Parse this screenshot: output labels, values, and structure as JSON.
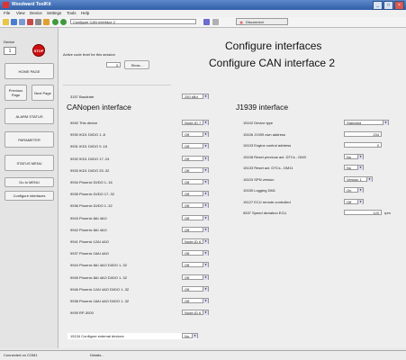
{
  "window": {
    "title": "Woodward ToolKit"
  },
  "menu": [
    "File",
    "View",
    "Device",
    "Settings",
    "Tools",
    "Help"
  ],
  "toolbar": {
    "combo_value": "Configure CAN Interface 2",
    "disconnect_label": "Disconnect"
  },
  "left": {
    "device_label": "Device",
    "device_number": "1",
    "stop_label": "STOP",
    "home": "HOME PAGE",
    "previous": "Previous Page",
    "next": "Next Page",
    "alarm": "ALARM STATUS",
    "parameter": "PARAMETER",
    "status_menu": "STATUS MENU",
    "goto_menu": "Go to MENU",
    "configure_interfaces": "Configure interfaces"
  },
  "header": {
    "title1": "Configure interfaces",
    "title2": "Configure CAN interface 2",
    "access_label": "Active code level for this session",
    "access_value": "3",
    "show_button": "Show..."
  },
  "baud": {
    "label": "3157 Baudrate",
    "value": "250 kBd"
  },
  "canopen": {
    "title": "CANopen interface",
    "rows": [
      {
        "label": "9940 This device",
        "value": "Node-ID 7"
      },
      {
        "label": "9930 IKD1 DI/DO 1..8",
        "value": "Off"
      },
      {
        "label": "9931 IKD1 DI/DO 9..16",
        "value": "Off"
      },
      {
        "label": "9932 IKD1 DI/DO 17..24",
        "value": "Off"
      },
      {
        "label": "9933 IKD1 DI/DO 25..32",
        "value": "Off"
      },
      {
        "label": "9934 Phoenix DI/DO 1..16",
        "value": "Off"
      },
      {
        "label": "9935 Phoenix DI/DO 17..32",
        "value": "Off"
      },
      {
        "label": "9936 Phoenix DI/DO 1..32",
        "value": "Off"
      },
      {
        "label": "9943 Phoenix 8AI 4AO",
        "value": "Off"
      },
      {
        "label": "9942 Phoenix 8AI 4AO",
        "value": "Off"
      },
      {
        "label": "9941 Phoenix 12AI 4AO",
        "value": "Node-ID 6"
      },
      {
        "label": "9937 Phoenix 16AI 4AO",
        "value": "Off"
      },
      {
        "label": "9944 Phoenix 8AI 4AO DI/DO 1..32",
        "value": "Off"
      },
      {
        "label": "9945 Phoenix 8AI 4AO DI/DO 1..32",
        "value": "Off"
      },
      {
        "label": "9946 Phoenix 12AI 4AO DI/DO 1..32",
        "value": "Off"
      },
      {
        "label": "9938 Phoenix 16AI 4AO DI/DO 1..32",
        "value": "Off"
      },
      {
        "label": "9939 RP-3000",
        "value": "Node-ID 6"
      }
    ],
    "external": {
      "label": "15134 Configure external devices",
      "value": "No"
    }
  },
  "j1939": {
    "title": "J1939 interface",
    "rows": [
      {
        "label": "15102 Device type",
        "value": "Standard",
        "kind": "select"
      },
      {
        "label": "15106 J1939 own address",
        "value": "234",
        "kind": "num"
      },
      {
        "label": "15103 Engine control address",
        "value": "0",
        "kind": "num"
      },
      {
        "label": "15108 Reset previous act. DTCs - DM3",
        "value": "No",
        "kind": "select"
      },
      {
        "label": "15133 Reset act. DTCs - DM11",
        "value": "No",
        "kind": "select"
      },
      {
        "label": "15103 SPN version",
        "value": "Version 1",
        "kind": "select"
      },
      {
        "label": "15150 Logging DM1",
        "value": "On",
        "kind": "select"
      },
      {
        "label": "15127 ECU remote controlled",
        "value": "Off",
        "kind": "select"
      },
      {
        "label": "5537 Speed deviation ECU",
        "value": "120",
        "unit": "rpm",
        "kind": "num"
      }
    ]
  },
  "status": {
    "left": "Connected on COM1",
    "details": "Details..."
  }
}
